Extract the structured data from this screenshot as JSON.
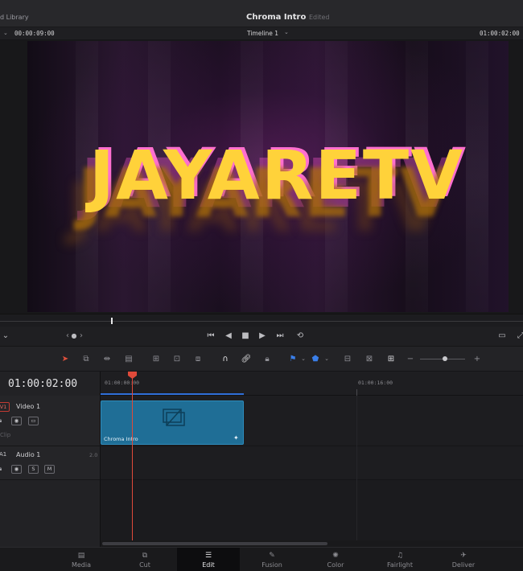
{
  "titlebar": {
    "library_label": "d Library",
    "project_title": "Chroma Intro",
    "status": "Edited"
  },
  "viewer": {
    "source_timecode": "00:00:09:00",
    "timeline_name": "Timeline 1",
    "record_timecode": "01:00:02:00",
    "video_title_text": "JAYARETV"
  },
  "timeline": {
    "current_timecode": "01:00:02:00",
    "ruler_labels": [
      "01:00:00:00",
      "01:00:16:00"
    ],
    "tracks": [
      {
        "id": "V1",
        "name": "Video 1",
        "sub": "Clip"
      },
      {
        "id": "A1",
        "name": "Audio 1",
        "channels": "2.0",
        "solo": "S",
        "mute": "M"
      }
    ],
    "clip_name": "Chroma Intro"
  },
  "pages": [
    {
      "label": "Media",
      "icon": "media-icon"
    },
    {
      "label": "Cut",
      "icon": "cut-icon"
    },
    {
      "label": "Edit",
      "icon": "edit-icon",
      "active": true
    },
    {
      "label": "Fusion",
      "icon": "fusion-icon"
    },
    {
      "label": "Color",
      "icon": "color-icon"
    },
    {
      "label": "Fairlight",
      "icon": "fairlight-icon"
    },
    {
      "label": "Deliver",
      "icon": "deliver-icon"
    }
  ]
}
